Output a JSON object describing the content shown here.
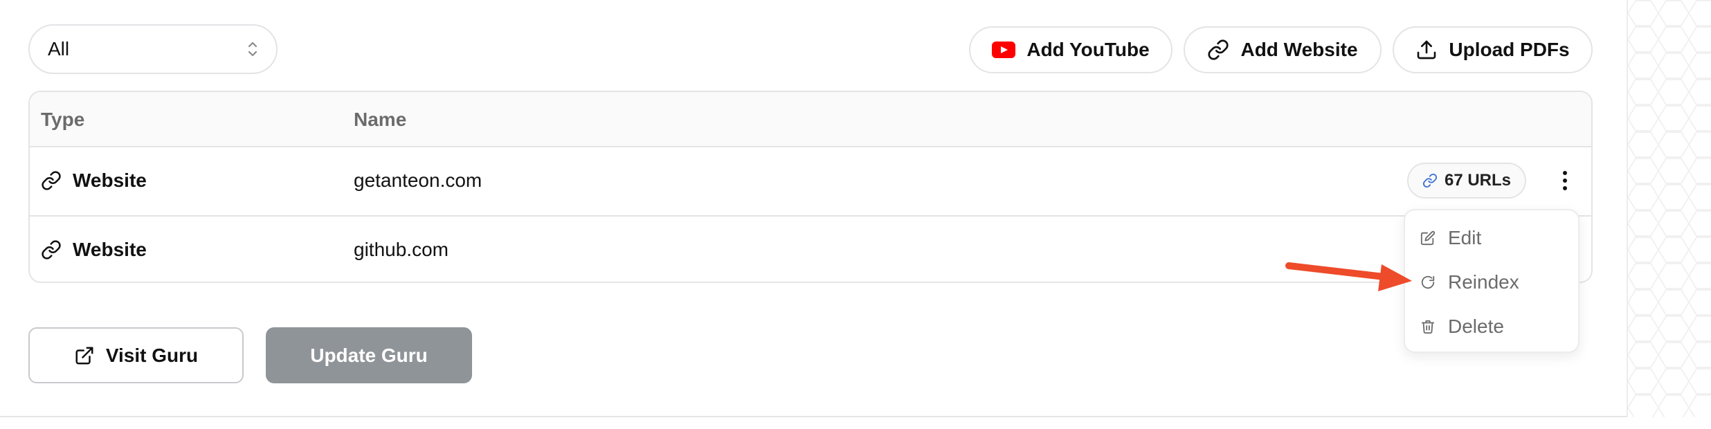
{
  "filter": {
    "selected": "All"
  },
  "actions": {
    "add_youtube": "Add YouTube",
    "add_website": "Add Website",
    "upload_pdfs": "Upload PDFs"
  },
  "table": {
    "columns": [
      "Type",
      "Name"
    ],
    "rows": [
      {
        "type": "Website",
        "name": "getanteon.com",
        "badge": "67 URLs"
      },
      {
        "type": "Website",
        "name": "github.com"
      }
    ]
  },
  "row_menu": {
    "items": [
      "Edit",
      "Reindex",
      "Delete"
    ]
  },
  "footer": {
    "visit_label": "Visit Guru",
    "update_label": "Update Guru"
  },
  "colors": {
    "youtube_red": "#ff0000",
    "annotation_arrow": "#ee4b2b",
    "disabled_button": "#8f9499",
    "link_icon_blue": "#3b6fd6"
  },
  "icons": [
    "youtube-icon",
    "link-icon",
    "upload-icon",
    "external-link-icon",
    "edit-icon",
    "refresh-icon",
    "trash-icon",
    "more-vertical-icon",
    "chevron-up-down-icon"
  ]
}
